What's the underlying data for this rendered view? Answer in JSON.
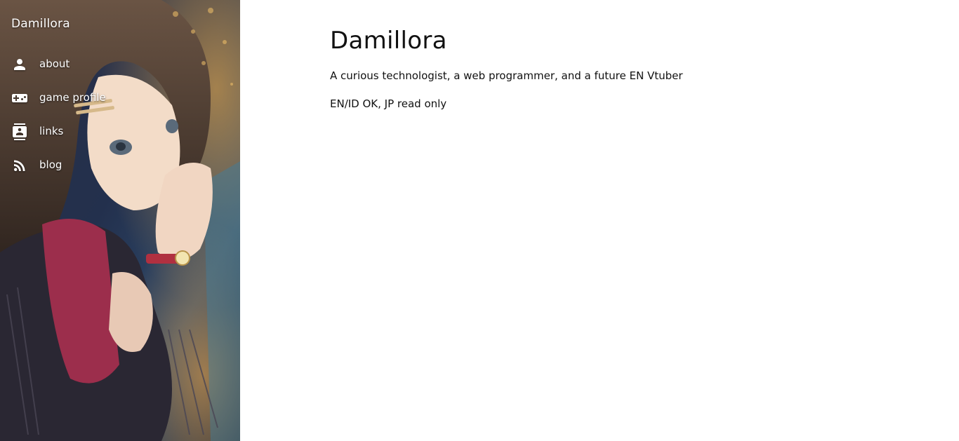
{
  "sidebar": {
    "site_name": "Damillora",
    "items": [
      {
        "label": "about",
        "icon": "person-icon"
      },
      {
        "label": "game profile",
        "icon": "gamepad-icon"
      },
      {
        "label": "links",
        "icon": "contact-card-icon"
      },
      {
        "label": "blog",
        "icon": "rss-icon"
      }
    ]
  },
  "main": {
    "title": "Damillora",
    "paragraphs": [
      "A curious technologist, a web programmer, and a future EN Vtuber",
      "EN/ID OK, JP read only"
    ]
  },
  "colors": {
    "sidebar_text": "#ffffff",
    "main_text": "#111111",
    "background": "#ffffff"
  }
}
